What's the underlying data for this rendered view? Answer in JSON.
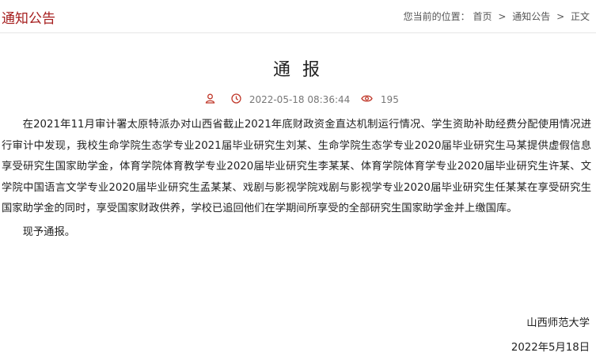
{
  "header": {
    "section_title": "通知公告",
    "breadcrumb": {
      "prefix": "您当前的位置：",
      "items": [
        "首页",
        "通知公告",
        "正文"
      ],
      "separator": ">"
    }
  },
  "article": {
    "title": "通 报",
    "meta": {
      "author_icon": "user-icon",
      "date_icon": "clock-icon",
      "date": "2022-05-18 08:36:44",
      "views_icon": "eye-icon",
      "views": "195",
      "icon_color": "#c0392b"
    },
    "paragraphs": [
      "在2021年11月审计署太原特派办对山西省截止2021年底财政资金直达机制运行情况、学生资助补助经费分配使用情况进行审计中发现，我校生命学院生态学专业2021届毕业研究生刘某、生命学院生态学专业2020届毕业研究生马某提供虚假信息享受研究生国家助学金，体育学院体育教学专业2020届毕业研究生李某某、体育学院体育学专业2020届毕业研究生许某、文学院中国语言文学专业2020届毕业研究生孟某某、戏剧与影视学院戏剧与影视学专业2020届毕业研究生任某某在享受研究生国家助学金的同时，享受国家财政供养，学校已追回他们在学期间所享受的全部研究生国家助学金并上缴国库。",
      "现予通报。"
    ],
    "signature": "山西师范大学",
    "sign_date": "2022年5月18日"
  },
  "colors": {
    "accent": "#a51d1d",
    "divider": "#e6e6e6"
  }
}
